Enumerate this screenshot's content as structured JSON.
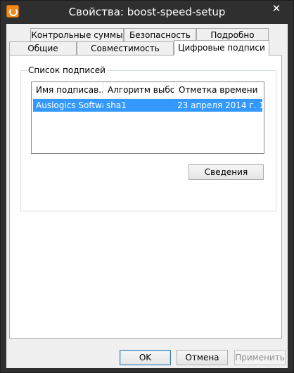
{
  "window": {
    "title": "Свойства: boost-speed-setup",
    "close_symbol": "✕",
    "app_icon": "boost-speed-icon"
  },
  "tabs": {
    "row1": [
      {
        "label": "Контрольные суммы"
      },
      {
        "label": "Безопасность"
      },
      {
        "label": "Подробно"
      }
    ],
    "row2": [
      {
        "label": "Общие"
      },
      {
        "label": "Совместимость"
      },
      {
        "label": "Цифровые подписи",
        "active": true
      }
    ]
  },
  "signatures": {
    "group_label": "Список подписей",
    "columns": [
      "Имя подписав...",
      "Алгоритм выбо...",
      "Отметка времени"
    ],
    "rows": [
      {
        "name": "Auslogics Softwa...",
        "algorithm": "sha1",
        "timestamp": "23 апреля 2014 г. 11...",
        "selected": true
      }
    ],
    "details_button": "Сведения"
  },
  "footer": {
    "ok_label": "OK",
    "cancel_label": "Отмена",
    "apply_label": "Применить",
    "apply_disabled": true
  },
  "colors": {
    "title_bar": "#2f2f2f",
    "selection": "#3399ff",
    "dialog_bg": "#f0f0f0"
  }
}
